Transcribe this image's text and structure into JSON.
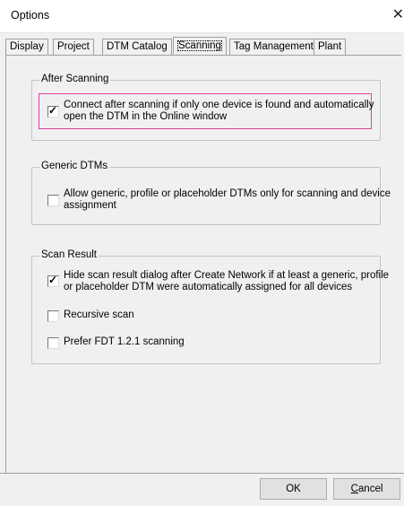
{
  "window": {
    "title": "Options",
    "close_glyph": "✕"
  },
  "tabs": [
    {
      "label": "Display"
    },
    {
      "label": "Project"
    },
    {
      "label": "DTM Catalog"
    },
    {
      "label": "Scanning"
    },
    {
      "label": "Tag Management"
    },
    {
      "label": "Plant"
    }
  ],
  "active_tab": "Scanning",
  "groups": {
    "after_scanning": {
      "title": "After Scanning",
      "connect": {
        "checked": true,
        "line1": "Connect after scanning if only one device is found and automatically",
        "line2": "open the DTM in the Online window"
      }
    },
    "generic_dtms": {
      "title": "Generic DTMs",
      "allow_generic": {
        "checked": false,
        "line1": "Allow generic, profile or placeholder DTMs only for scanning and device",
        "line2": "assignment"
      }
    },
    "scan_result": {
      "title": "Scan Result",
      "hide_dialog": {
        "checked": true,
        "line1": "Hide scan result dialog after Create Network if at least a generic, profile",
        "line2": "or placeholder DTM were automatically assigned for all devices"
      },
      "recursive": {
        "checked": false,
        "label": "Recursive scan"
      },
      "prefer_fdt": {
        "checked": false,
        "label": "Prefer FDT 1.2.1 scanning"
      }
    }
  },
  "buttons": {
    "ok": "OK",
    "cancel_accel": "C",
    "cancel_rest": "ancel"
  },
  "colors": {
    "highlight_border": "#e040a0"
  }
}
